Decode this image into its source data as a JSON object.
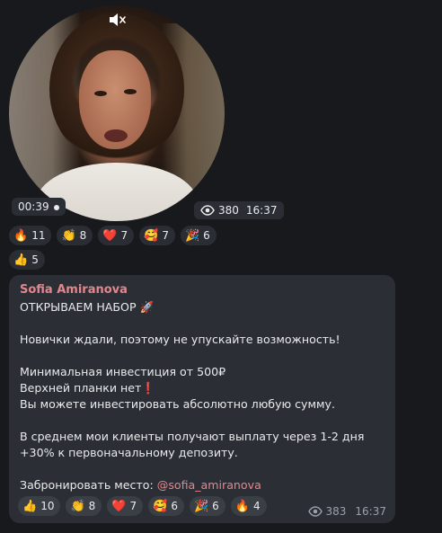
{
  "video": {
    "duration": "00:39",
    "views": "380",
    "time": "16:37"
  },
  "reactions_top": [
    {
      "emoji": "🔥",
      "count": "11"
    },
    {
      "emoji": "👏",
      "count": "8"
    },
    {
      "emoji": "❤️",
      "count": "7"
    },
    {
      "emoji": "🥰",
      "count": "7"
    },
    {
      "emoji": "🎉",
      "count": "6"
    },
    {
      "emoji": "👍",
      "count": "5"
    }
  ],
  "message": {
    "author": "Sofia Amiranova",
    "line1": "ОТКРЫВАЕМ НАБОР",
    "line1_emoji": "🚀",
    "line2": "Новички ждали, поэтому не упускайте возможность!",
    "line3": "Минимальная инвестиция от 500₽",
    "line4": "Верхней планки нет",
    "line4_emoji": "❗",
    "line5": "Вы можете инвестировать абсолютно любую сумму.",
    "line6": "В среднем мои клиенты получают выплату через 1-2 дня +30% к первоначальному депозиту.",
    "line7_prefix": "Забронировать место: ",
    "line7_mention": "@sofia_amiranova",
    "views": "383",
    "time": "16:37"
  },
  "reactions_bottom": [
    {
      "emoji": "👍",
      "count": "10"
    },
    {
      "emoji": "👏",
      "count": "8"
    },
    {
      "emoji": "❤️",
      "count": "7"
    },
    {
      "emoji": "🥰",
      "count": "6"
    },
    {
      "emoji": "🎉",
      "count": "6"
    },
    {
      "emoji": "🔥",
      "count": "4"
    }
  ],
  "colors": {
    "background": "#17191c",
    "bubble": "#2b2f35",
    "accent_name": "#e3878d",
    "pill": "#2a2e34"
  },
  "icons": [
    "mute-icon",
    "eye-icon"
  ]
}
